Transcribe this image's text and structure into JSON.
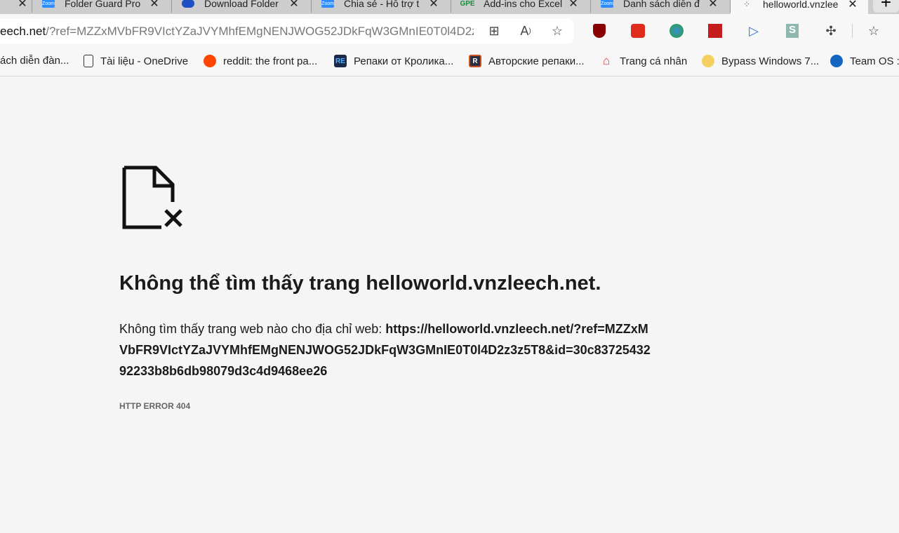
{
  "tabs": [
    {
      "title": "",
      "favicon": "tab-icon"
    },
    {
      "title": "Folder Guard Pro",
      "favicon": "zoom-icon"
    },
    {
      "title": "Download Folder",
      "favicon": "cloud-icon"
    },
    {
      "title": "Chia sẻ - Hỗ trợ t",
      "favicon": "zoom-icon"
    },
    {
      "title": "Add-ins cho Excel",
      "favicon": "gpe-icon"
    },
    {
      "title": "Danh sách diễn đ",
      "favicon": "zoom-icon"
    },
    {
      "title": "helloworld.vnzlee",
      "favicon": "loading-icon",
      "active": true
    }
  ],
  "address": {
    "host": "eech.net",
    "rest": "/?ref=MZZxMVbFR9VIctYZaJVYMhfEMgNENJWOG52JDkFqW3GMnIE0T0l4D2z..."
  },
  "bookmarks": [
    {
      "label": "ách diễn đàn..."
    },
    {
      "label": "Tài liệu - OneDrive"
    },
    {
      "label": "reddit: the front pa..."
    },
    {
      "label": "Репаки от Кролика..."
    },
    {
      "label": "Авторские репаки..."
    },
    {
      "label": "Trang cá nhân"
    },
    {
      "label": "Bypass Windows 7..."
    },
    {
      "label": "Team OS :"
    }
  ],
  "error": {
    "icon": "file-not-found-icon",
    "title": "Không thể tìm thấy trang helloworld.vnzleech.net.",
    "message_prefix": "Không tìm thấy trang web nào cho địa chỉ web: ",
    "url": "https://helloworld.vnzleech.net/?ref=MZZxMVbFR9VIctYZaJVYMhfEMgNENJWOG52JDkFqW3GMnIE0T0l4D2z3z5T8&id=30c8372543292233b8b6db98079d3c4d9468ee26",
    "code": "HTTP ERROR 404"
  }
}
